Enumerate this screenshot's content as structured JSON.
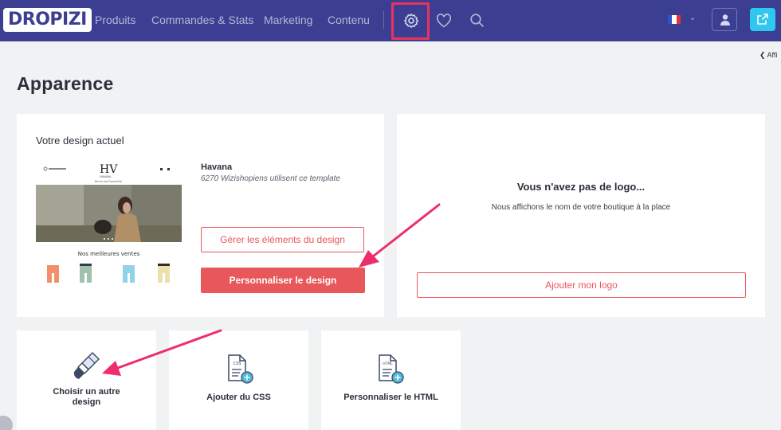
{
  "nav": {
    "logo": "DROPIZI",
    "links": [
      "Produits",
      "Commandes & Stats",
      "Marketing",
      "Contenu"
    ]
  },
  "back_link": "❮  Affi",
  "page_title": "Apparence",
  "design_card": {
    "title": "Votre design actuel",
    "template_name": "Havana",
    "template_users": "6270 Wizishopiens utilisent ce template",
    "preview_brand": "HAVANA",
    "preview_menu": "Bermuda   Espadrille",
    "preview_section": "Nos meilleures ventes",
    "manage_button": "Gérer les éléments du design",
    "customize_button": "Personnaliser le design"
  },
  "logo_card": {
    "title": "Vous n'avez pas de logo...",
    "subtitle": "Nous affichons le nom de votre boutique à la place",
    "add_logo_button": "Ajouter mon logo"
  },
  "actions": [
    {
      "label": "Choisir un autre design"
    },
    {
      "label": "Ajouter du CSS",
      "icon_text": "CSS"
    },
    {
      "label": "Personnaliser le HTML",
      "icon_text": "HTML"
    }
  ],
  "colors": {
    "nav_bg": "#3c3f91",
    "accent": "#e8575a",
    "highlight": "#e8335f",
    "external_button": "#2fc7f0"
  }
}
